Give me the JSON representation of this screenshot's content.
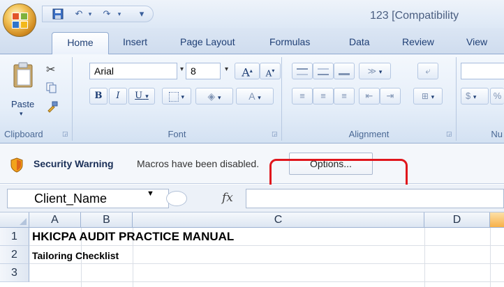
{
  "window": {
    "title": "123  [Compatibility"
  },
  "quick_access": {
    "icons": [
      "save-icon",
      "undo-icon",
      "redo-icon",
      "customize-icon"
    ],
    "glyphs": {
      "undo": "↶",
      "redo": "↷",
      "customize": "▾",
      "dropdown": "▾"
    }
  },
  "tabs": [
    "Home",
    "Insert",
    "Page Layout",
    "Formulas",
    "Data",
    "Review",
    "View"
  ],
  "active_tab": "Home",
  "ribbon": {
    "clipboard": {
      "label": "Clipboard",
      "paste_label": "Paste"
    },
    "font": {
      "label": "Font",
      "font_name": "Arial",
      "font_size": "8",
      "grow_label": "A",
      "shrink_label": "A",
      "bold": "B",
      "italic": "I",
      "underline": "U",
      "font_color": "A"
    },
    "alignment": {
      "label": "Alignment"
    },
    "number": {
      "label": "Nu",
      "currency": "$",
      "percent": "%"
    }
  },
  "security_bar": {
    "title": "Security Warning",
    "message": "Macros have been disabled.",
    "options_label": "Options..."
  },
  "formula_bar": {
    "name_box": "Client_Name",
    "fx": "fx",
    "value": ""
  },
  "sheet": {
    "columns": [
      "A",
      "B",
      "C",
      "D",
      ""
    ],
    "selected_column": "",
    "rows": [
      "1",
      "2",
      "3"
    ],
    "cells": {
      "A1": "HKICPA AUDIT PRACTICE MANUAL",
      "A2": "Tailoring Checklist"
    }
  },
  "colors": {
    "highlight": "#e0161c",
    "ribbon": "#dfe9f5",
    "selected_header": "#f8b048"
  }
}
